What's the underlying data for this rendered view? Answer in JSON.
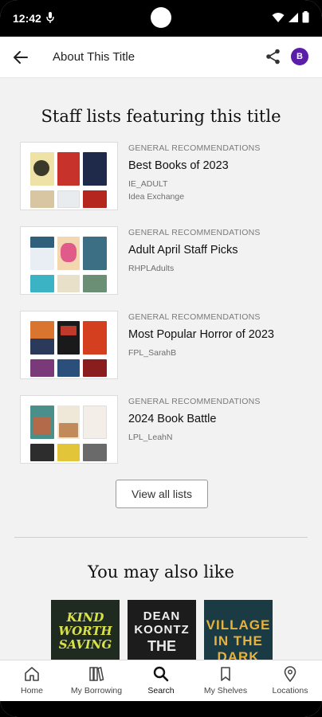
{
  "status_bar": {
    "time": "12:42"
  },
  "app_bar": {
    "title": "About This Title",
    "avatar_letter": "B"
  },
  "staff_lists": {
    "title": "Staff lists featuring this title",
    "items": [
      {
        "category": "GENERAL RECOMMENDATIONS",
        "name": "Best Books of 2023",
        "owner": "IE_ADULT",
        "library": "Idea Exchange"
      },
      {
        "category": "GENERAL RECOMMENDATIONS",
        "name": "Adult April Staff Picks",
        "owner": "RHPLAdults",
        "library": ""
      },
      {
        "category": "GENERAL RECOMMENDATIONS",
        "name": "Most Popular Horror of 2023",
        "owner": "FPL_SarahB",
        "library": ""
      },
      {
        "category": "GENERAL RECOMMENDATIONS",
        "name": "2024 Book Battle",
        "owner": "LPL_LeahN",
        "library": ""
      }
    ],
    "view_all_label": "View all lists"
  },
  "also_like": {
    "title": "You may also like",
    "covers": [
      {
        "title_text": "KIND WORTH SAVING",
        "author_text": ""
      },
      {
        "title_text": "THE",
        "author_text": "DEAN KOONTZ"
      },
      {
        "title_text": "VILLAGE IN THE DARK",
        "author_text": ""
      }
    ]
  },
  "bottom_nav": [
    {
      "label": "Home",
      "icon": "home-icon"
    },
    {
      "label": "My Borrowing",
      "icon": "books-icon"
    },
    {
      "label": "Search",
      "icon": "search-icon",
      "active": true
    },
    {
      "label": "My Shelves",
      "icon": "bookmark-icon"
    },
    {
      "label": "Locations",
      "icon": "location-pin-icon"
    }
  ],
  "colors": {
    "avatar": "#5a1ea8",
    "background": "#f2f2f2"
  }
}
